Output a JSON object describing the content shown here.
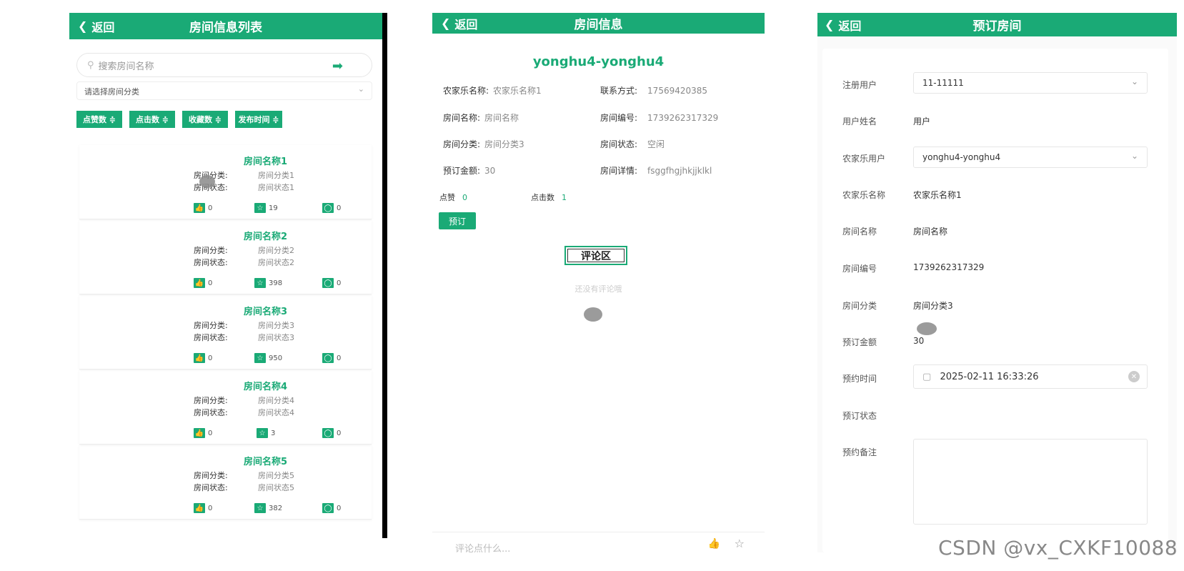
{
  "panel1": {
    "back_label": "返回",
    "title": "房间信息列表",
    "search_placeholder": "搜索房间名称",
    "category_placeholder": "请选择房间分类",
    "sort_buttons": [
      "点赞数 ≑",
      "点击数 ≑",
      "收藏数 ≑",
      "发布时间 ≑"
    ],
    "rooms": [
      {
        "name": "房间名称1",
        "cat_label": "房间分类:",
        "cat": "房间分类1",
        "status_label": "房间状态:",
        "status": "房间状态1",
        "likes": "0",
        "stars": "19",
        "comments": "0"
      },
      {
        "name": "房间名称2",
        "cat_label": "房间分类:",
        "cat": "房间分类2",
        "status_label": "房间状态:",
        "status": "房间状态2",
        "likes": "0",
        "stars": "398",
        "comments": "0"
      },
      {
        "name": "房间名称3",
        "cat_label": "房间分类:",
        "cat": "房间分类3",
        "status_label": "房间状态:",
        "status": "房间状态3",
        "likes": "0",
        "stars": "950",
        "comments": "0"
      },
      {
        "name": "房间名称4",
        "cat_label": "房间分类:",
        "cat": "房间分类4",
        "status_label": "房间状态:",
        "status": "房间状态4",
        "likes": "0",
        "stars": "3",
        "comments": "0"
      },
      {
        "name": "房间名称5",
        "cat_label": "房间分类:",
        "cat": "房间分类5",
        "status_label": "房间状态:",
        "status": "房间状态5",
        "likes": "0",
        "stars": "382",
        "comments": "0"
      }
    ]
  },
  "panel2": {
    "back_label": "返回",
    "title": "房间信息",
    "heading": "yonghu4-yonghu4",
    "fields": {
      "nongjiale_name_label": "农家乐名称:",
      "nongjiale_name": "农家乐名称1",
      "contact_label": "联系方式:",
      "contact": "17569420385",
      "room_name_label": "房间名称:",
      "room_name": "房间名称",
      "room_no_label": "房间编号:",
      "room_no": "1739262317329",
      "room_cat_label": "房间分类:",
      "room_cat": "房间分类3",
      "room_status_label": "房间状态:",
      "room_status": "空闲",
      "price_label": "预订金额:",
      "price": "30",
      "detail_label": "房间详情:",
      "detail": "fsggfhgjhkjjklkl"
    },
    "likes_label": "点赞",
    "likes": "0",
    "clicks_label": "点击数",
    "clicks": "1",
    "book_button": "预订",
    "comment_heading": "评论区",
    "no_comment": "还没有评论哦",
    "comment_placeholder": "评论点什么..."
  },
  "panel3": {
    "back_label": "返回",
    "title": "预订房间",
    "rows": {
      "user_label": "注册用户",
      "user": "11-11111",
      "username_label": "用户姓名",
      "username": "用户",
      "nongjiale_user_label": "农家乐用户",
      "nongjiale_user": "yonghu4-yonghu4",
      "nongjiale_name_label": "农家乐名称",
      "nongjiale_name": "农家乐名称1",
      "room_name_label": "房间名称",
      "room_name": "房间名称",
      "room_no_label": "房间编号",
      "room_no": "1739262317329",
      "room_cat_label": "房间分类",
      "room_cat": "房间分类3",
      "price_label": "预订金额",
      "price": "30",
      "time_label": "预约时间",
      "time": "2025-02-11 16:33:26",
      "status_label": "预订状态",
      "note_label": "预约备注"
    }
  },
  "watermark": "CSDN @vx_CXKF10088",
  "colors": {
    "accent": "#1aaa76"
  }
}
